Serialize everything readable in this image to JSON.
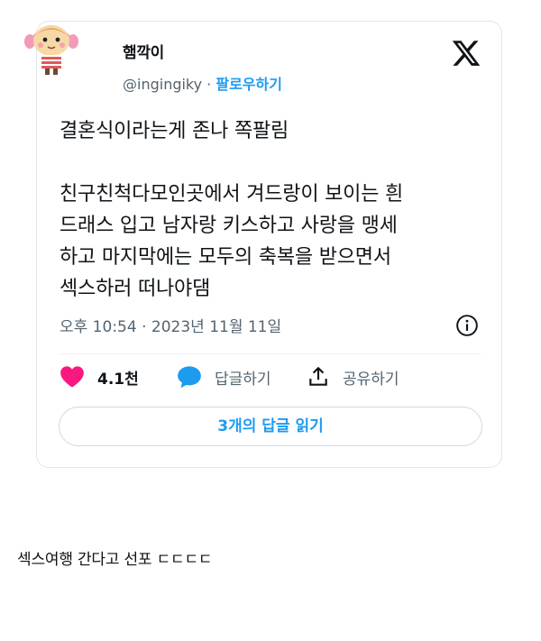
{
  "tweet": {
    "display_name": "햄깍이",
    "handle": "@ingingiky",
    "separator": " · ",
    "follow_label": "팔로우하기",
    "text_paragraph_1": "결혼식이라는게 존나 쪽팔림",
    "text_paragraph_2": "친구친척다모인곳에서 겨드랑이 보이는 흰\n드래스 입고 남자랑 키스하고 사랑을 맹세\n하고 마지막에는 모두의 축복을 받으면서\n섹스하러 떠나야댐",
    "timestamp": "오후 10:54 · 2023년 11월 11일",
    "like_count": "4.1천",
    "reply_label": "답글하기",
    "share_label": "공유하기",
    "read_replies_label": "3개의 답글 읽기",
    "icons": {
      "logo": "x-logo-icon",
      "info": "info-icon",
      "like": "heart-icon",
      "reply": "speech-bubble-icon",
      "share": "share-icon"
    },
    "colors": {
      "like": "#f91880",
      "reply": "#1d9bf0",
      "link": "#1d9bf0",
      "muted": "#536471"
    }
  },
  "caption": "섹스여행 간다고 선포 ㄷㄷㄷㄷ"
}
